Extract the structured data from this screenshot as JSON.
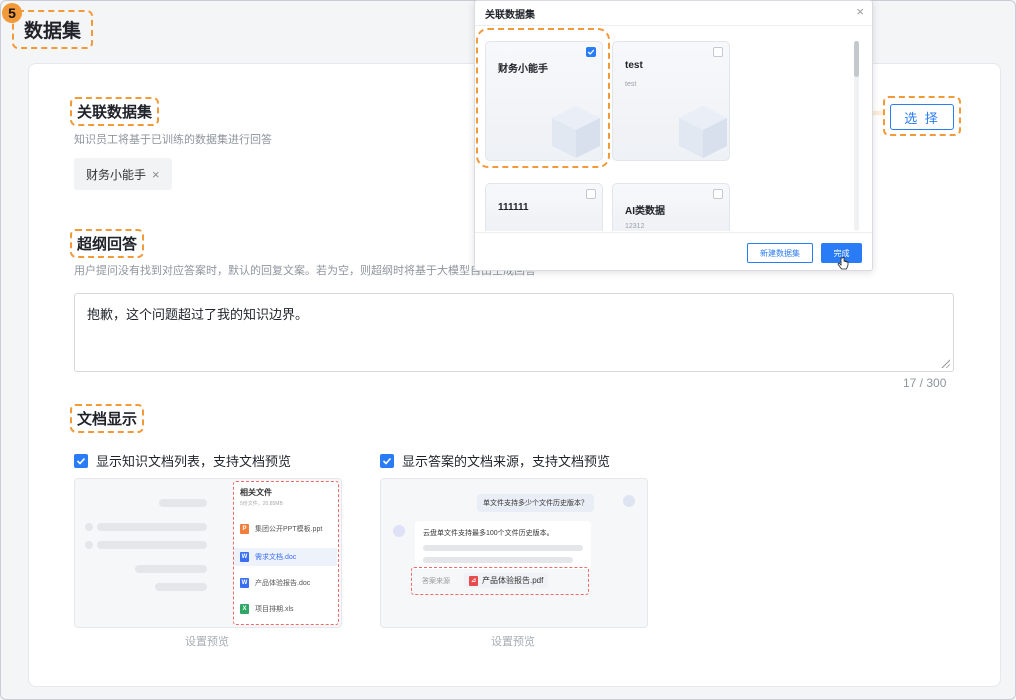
{
  "step_number": "5",
  "page_title": "数据集",
  "linked_datasets": {
    "title": "关联数据集",
    "description": "知识员工将基于已训练的数据集进行回答",
    "tag": "财务小能手",
    "select_label": "选 择"
  },
  "fallback": {
    "title": "超纲回答",
    "description": "用户提问没有找到对应答案时，默认的回复文案。若为空，则超纲时将基于大模型自由生成回答",
    "value": "抱歉，这个问题超过了我的知识边界。",
    "counter": "17 / 300"
  },
  "doc_display": {
    "title": "文档显示",
    "option1": {
      "label": "显示知识文档列表，支持文档预览",
      "preview_caption": "设置预览",
      "panel_title": "相关文件",
      "panel_sub": "5份文件，20.85MB",
      "files": [
        {
          "name": "集团公开PPT模板.ppt",
          "type": "P",
          "color": "#f07f3c"
        },
        {
          "name": "需求文档.doc",
          "type": "W",
          "color": "#3a6ff2"
        },
        {
          "name": "产品体验报告.doc",
          "type": "W",
          "color": "#3a6ff2"
        },
        {
          "name": "项目排期.xls",
          "type": "X",
          "color": "#2fa866"
        }
      ]
    },
    "option2": {
      "label": "显示答案的文档来源，支持文档预览",
      "preview_caption": "设置预览",
      "question": "单文件支持多少个文件历史版本？",
      "answer": "云盘单文件支持最多100个文件历史版本。",
      "source_label": "答案来源",
      "source_file": "产品体验报告.pdf"
    }
  },
  "modal": {
    "title": "关联数据集",
    "close": "×",
    "cards": [
      {
        "name": "财务小能手",
        "sub": "",
        "checked": true
      },
      {
        "name": "test",
        "sub": "test",
        "checked": false
      },
      {
        "name": "111111",
        "sub": "",
        "checked": false
      },
      {
        "name": "AI类数据",
        "sub": "12312",
        "checked": false
      }
    ],
    "new_button": "新建数据集",
    "ok_button": "完成"
  },
  "colors": {
    "accent": "#2a7cf6",
    "highlight": "#f29a3a",
    "arrow": "#f29a3a"
  }
}
